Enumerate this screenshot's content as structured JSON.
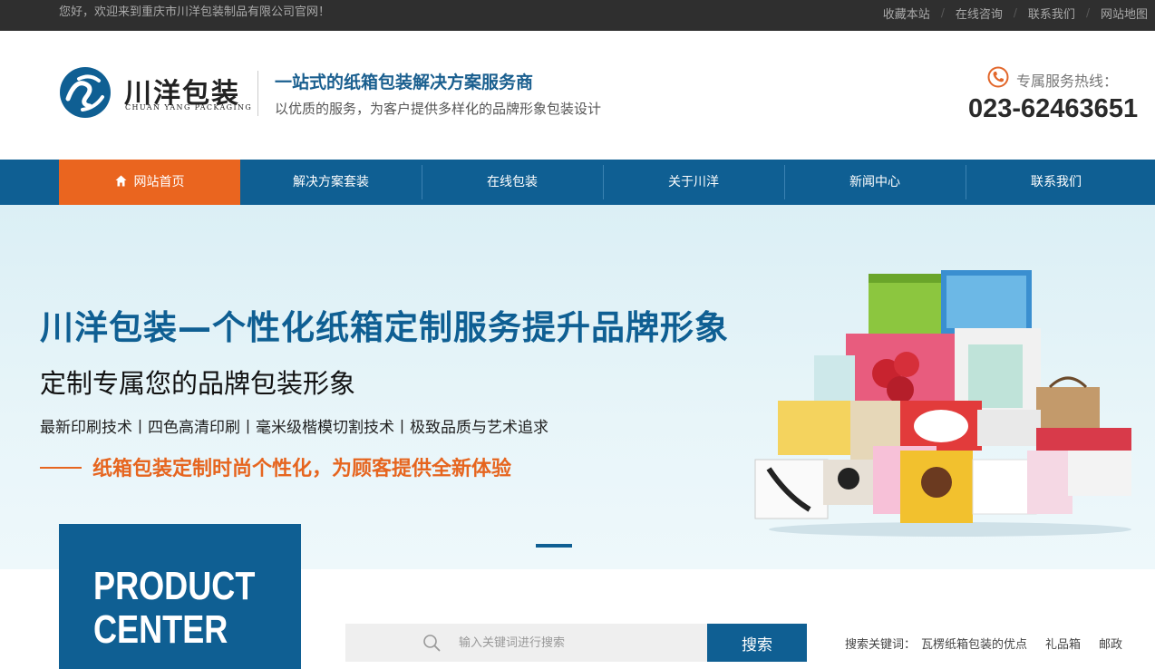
{
  "topbar": {
    "welcome": "您好，欢迎来到重庆市川洋包装制品有限公司官网！",
    "links": [
      "收藏本站",
      "在线咨询",
      "联系我们",
      "网站地图"
    ]
  },
  "header": {
    "logo_cn": "川洋包装",
    "logo_en": "CHUAN YANG PACKAGING",
    "slogan": "一站式的纸箱包装解决方案服务商",
    "subslogan": "以优质的服务，为客户提供多样化的品牌形象包装设计",
    "hotline_label": "专属服务热线：",
    "hotline_number": "023-62463651"
  },
  "nav": {
    "items": [
      "网站首页",
      "解决方案套装",
      "在线包装",
      "关于川洋",
      "新闻中心",
      "联系我们"
    ],
    "active_index": 0
  },
  "banner": {
    "title": "川洋包装—个性化纸箱定制服务提升品牌形象",
    "sub1": "定制专属您的品牌包装形象",
    "sub2": "最新印刷技术丨四色高清印刷丨毫米级楷模切割技术丨极致品质与艺术追求",
    "sub3": "纸箱包装定制时尚个性化，为顾客提供全新体验"
  },
  "product_center": {
    "line1": "PRODUCT",
    "line2": "CENTER"
  },
  "search": {
    "placeholder": "输入关键词进行搜索",
    "button": "搜索",
    "keywords_label": "搜索关键词：",
    "keywords": [
      "瓦楞纸箱包装的优点",
      "礼品箱",
      "邮政"
    ]
  },
  "colors": {
    "primary": "#0f5f93",
    "accent": "#ea651f",
    "topbar": "#2f2f2f"
  }
}
